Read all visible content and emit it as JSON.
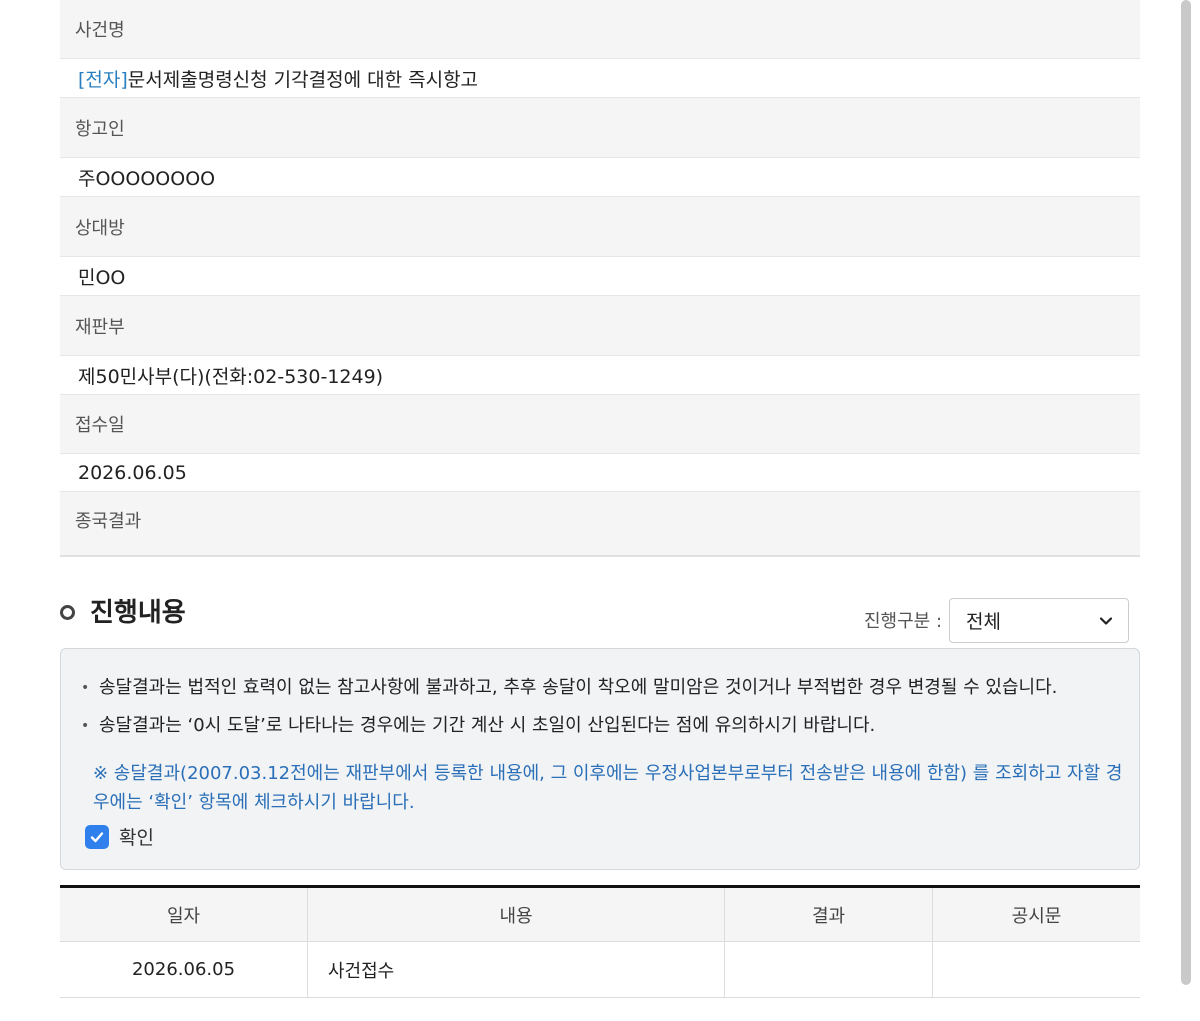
{
  "case_info": {
    "case_name_label": "사건명",
    "case_name_tag": "[전자]",
    "case_name_value": "문서제출명령신청 기각결정에 대한 즉시항고",
    "appellant_label": "항고인",
    "appellant_value": "주OOOOOOOO",
    "opponent_label": "상대방",
    "opponent_value": "민OO",
    "court_label": "재판부",
    "court_value": "제50민사부(다)(전화:02-530-1249)",
    "received_label": "접수일",
    "received_value": "2026.06.05",
    "result_label": "종국결과"
  },
  "progress": {
    "title": "진행내용",
    "filter_label": "진행구분 :",
    "filter_selected": "전체",
    "notices": [
      "송달결과는 법적인 효력이 없는 참고사항에 불과하고, 추후 송달이 착오에 말미암은 것이거나 부적법한 경우 변경될 수 있습니다.",
      "송달결과는 ‘0시 도달’로 나타나는 경우에는 기간 계산 시 초일이 산입된다는 점에 유의하시기 바랍니다."
    ],
    "note": "※ 송달결과(2007.03.12전에는 재판부에서 등록한 내용에, 그 이후에는 우정사업본부로부터 전송받은 내용에 한함) 를 조회하고 자할 경우에는 ‘확인’ 항목에 체크하시기 바랍니다.",
    "confirm_label": "확인",
    "confirm_checked": true
  },
  "table": {
    "headers": [
      "일자",
      "내용",
      "결과",
      "공시문"
    ],
    "rows": [
      {
        "date": "2026.06.05",
        "content": "사건접수",
        "result": "",
        "notice": ""
      }
    ]
  },
  "colors": {
    "accent": "#2f80ed",
    "note_blue": "#2a6fb8",
    "tag_blue": "#2a7fbf"
  }
}
